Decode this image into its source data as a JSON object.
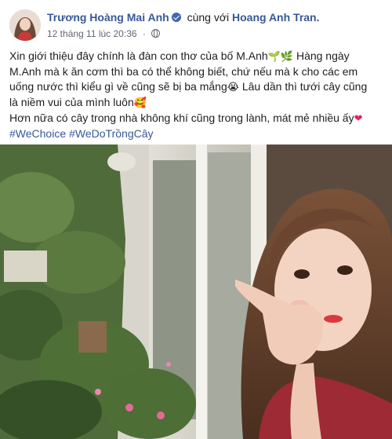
{
  "post": {
    "author": "Trương Hoàng Mai Anh",
    "with_text": "cùng với",
    "tagged_name": "Hoang Anh Tran.",
    "timestamp": "12 tháng 11 lúc 20:36",
    "meta_separator": "·",
    "privacy_icon": "globe-icon",
    "lines": [
      {
        "text": "Xin giới thiệu đây chính là đàn con thơ của bố M.Anh",
        "emoji": "🌱🌿",
        "tail": " Hàng ngày"
      },
      {
        "text": "M.Anh mà k ăn cơm thì ba có thể không biết, chứ nếu mà k cho các em"
      },
      {
        "text": "uống nước thì kiểu gì về cũng sẽ bị ba mắng",
        "emoji": "😭",
        "tail": " Lâu dần thì tưới cây cũng"
      },
      {
        "text": "là niềm vui của mình luôn",
        "emoji": "🥰"
      },
      {
        "text": "Hơn nữa có cây trong nhà không khí cũng trong lành, mát mẻ nhiều ấy",
        "emoji": "❤"
      }
    ],
    "hashtags": [
      "#WeChoice",
      "#WeDoTrồngCây"
    ]
  },
  "colors": {
    "link": "#385898",
    "text": "#1c1e21",
    "meta": "#616770",
    "verified": "#4267b2"
  }
}
